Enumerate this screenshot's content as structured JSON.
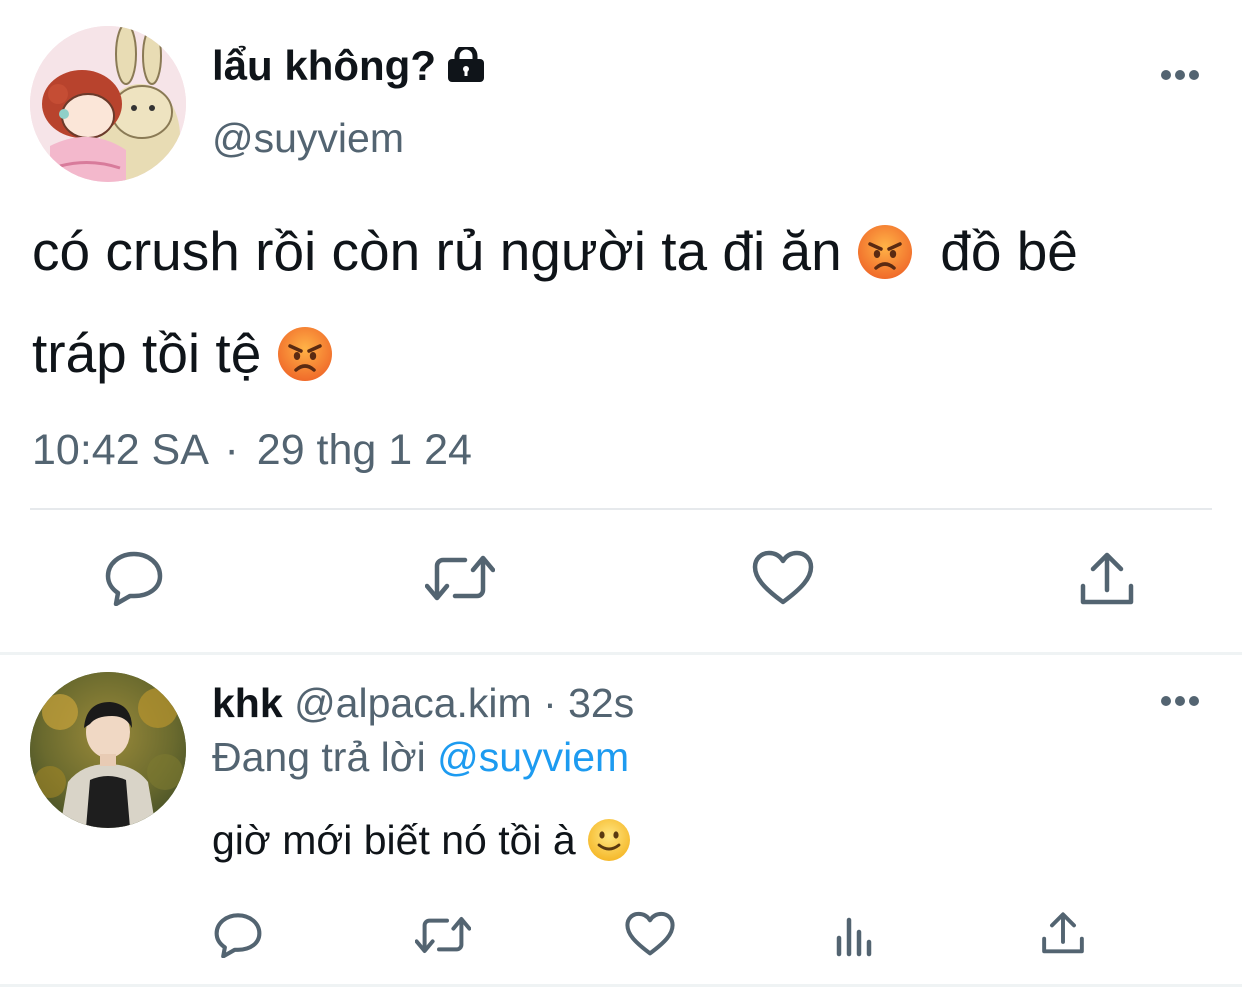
{
  "main_tweet": {
    "display_name": "lẩu không?",
    "protected_icon": "lock-icon",
    "handle": "@suyviem",
    "text_line1": "có crush rồi còn rủ người ta đi ăn",
    "text_mid": "đồ bê",
    "text_line2": "tráp tồi tệ",
    "emoji": "angry-face-emoji",
    "time": "10:42 SA",
    "separator": "·",
    "date": "29 thg 1 24",
    "actions": [
      "reply-icon",
      "retweet-icon",
      "like-icon",
      "share-icon"
    ]
  },
  "reply": {
    "display_name": "khk",
    "handle": "@alpaca.kim",
    "separator": "·",
    "age": "32s",
    "replying_label": "Đang trả lời",
    "replying_mention": "@suyviem",
    "text": "giờ mới biết nó tồi à",
    "emoji": "slightly-smiling-face-emoji",
    "actions": [
      "reply-icon",
      "retweet-icon",
      "like-icon",
      "views-icon",
      "share-icon"
    ]
  },
  "colors": {
    "text": "#0f1419",
    "secondary": "#536471",
    "link": "#1d9bf0",
    "divider": "#eff3f4",
    "emoji_angry": "#f06a2a",
    "emoji_smile": "#fbcf3c"
  }
}
